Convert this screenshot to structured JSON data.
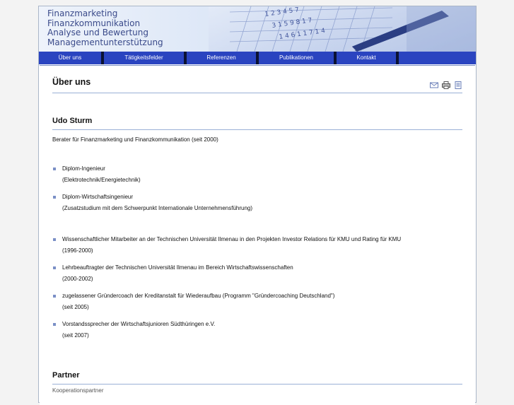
{
  "banner": {
    "lines": [
      "Finanzmarketing",
      "Finanzkommunikation",
      "Analyse und Bewertung",
      "Managementunterstützung"
    ]
  },
  "nav": {
    "items": [
      "Über uns",
      "Tätigkeitsfelder",
      "Referenzen",
      "Publikationen",
      "Kontakt"
    ]
  },
  "page_title": "Über uns",
  "tools": [
    "email-icon",
    "print-icon",
    "document-icon"
  ],
  "person": {
    "name": "Udo Sturm",
    "role": "Berater für Finanzmarketing und Finanzkommunikation (seit 2000)"
  },
  "education": [
    {
      "line1": "Diplom-Ingenieur",
      "line2": "(Elektrotechnik/Energietechnik)"
    },
    {
      "line1": "Diplom-Wirtschaftsingenieur",
      "line2": "(Zusatzstudium mit dem Schwerpunkt Internationale Unternehmensführung)"
    }
  ],
  "experience": [
    {
      "line1": "Wissenschaftlicher Mitarbeiter an der Technischen Universität Ilmenau in den Projekten Investor Relations für KMU und Rating für KMU",
      "line2": "(1996-2000)"
    },
    {
      "line1": "Lehrbeauftragter der Technischen Universität Ilmenau im Bereich Wirtschaftswissenschaften",
      "line2": "(2000-2002)"
    },
    {
      "line1": "zugelassener Gründercoach der Kreditanstalt für Wiederaufbau (Programm \"Gründercoaching Deutschland\")",
      "line2": "(seit 2005)"
    },
    {
      "line1": "Vorstandssprecher der Wirtschaftsjunioren Südthüringen e.V.",
      "line2": "(seit 2007)"
    }
  ],
  "partner_heading": "Partner",
  "partner_cutoff": "Kooperationspartner"
}
